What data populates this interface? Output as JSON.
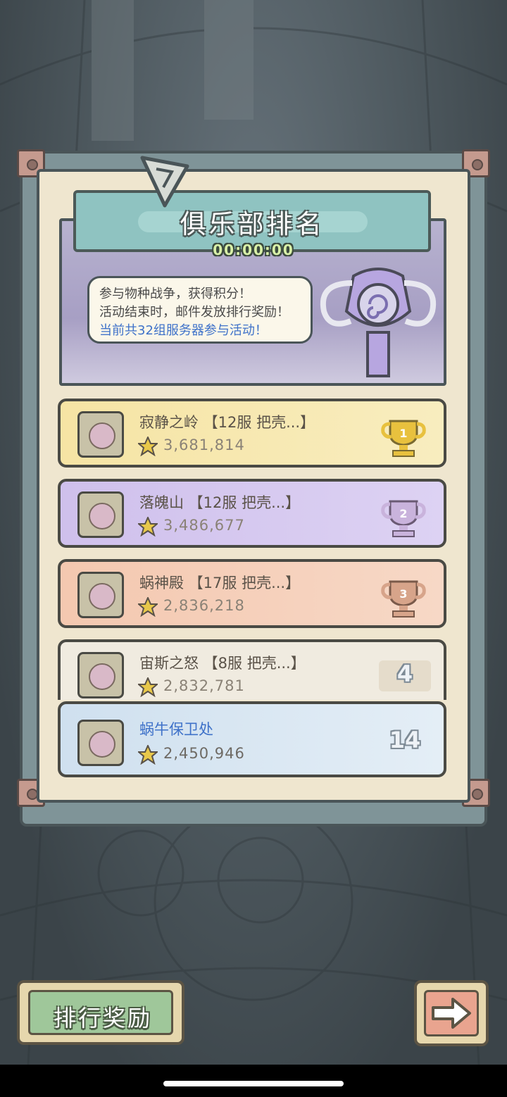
{
  "header": {
    "title": "俱乐部排名",
    "timer": "00:00:00"
  },
  "info": {
    "line1": "参与物种战争，获得积分！",
    "line2": "活动结束时，邮件发放排行奖励！",
    "line3": "当前共32组服务器参与活动！"
  },
  "rankings": [
    {
      "name": "寂静之岭 【12服 把壳...】",
      "score": "3,681,814",
      "rank": "1",
      "medal": "gold"
    },
    {
      "name": "落魄山 【12服 把壳...】",
      "score": "3,486,677",
      "rank": "2",
      "medal": "silver"
    },
    {
      "name": "蜗神殿 【17服 把壳...】",
      "score": "2,836,218",
      "rank": "3",
      "medal": "bronze"
    },
    {
      "name": "宙斯之怒 【8服 把壳...】",
      "score": "2,832,781",
      "rank": "4"
    }
  ],
  "my_club": {
    "name": "蜗牛保卫处",
    "score": "2,450,946",
    "rank": "14"
  },
  "buttons": {
    "reward_label": "排行奖励",
    "next_icon": "arrow-right-icon"
  },
  "colors": {
    "gold_card": "#f6e4a4",
    "purple_card": "#cfc0ec",
    "orange_card": "#f4c8b0",
    "my_card": "#cfe0ef",
    "highlight_text": "#3f72c9"
  }
}
